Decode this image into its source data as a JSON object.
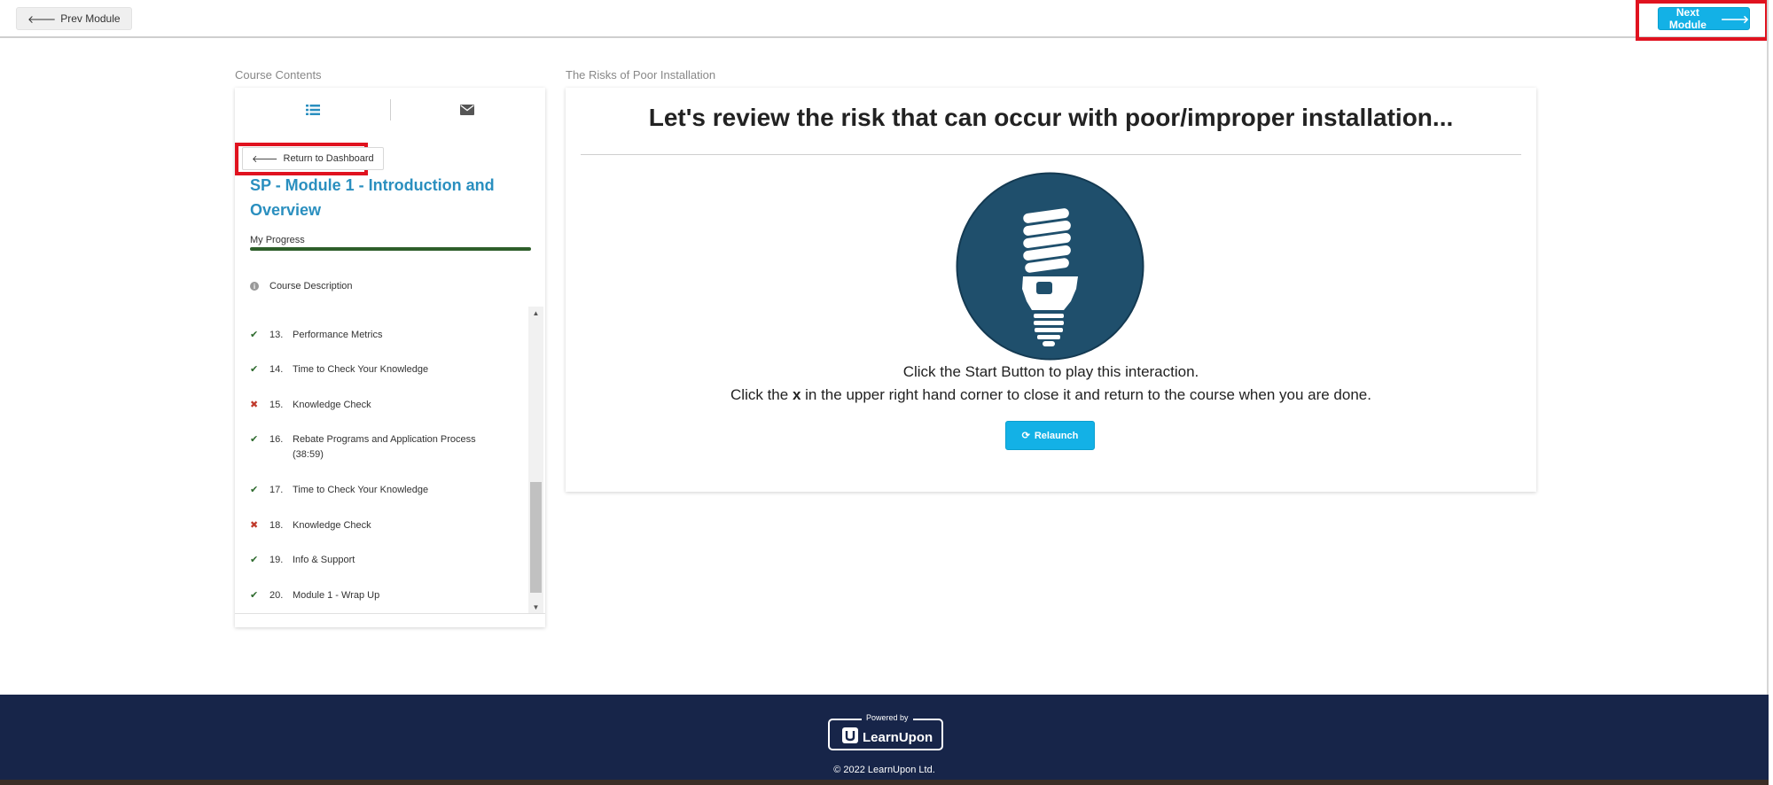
{
  "topbar": {
    "prev_label": "Prev Module",
    "next_label": "Next Module"
  },
  "sidebar": {
    "heading": "Course Contents",
    "return_label": "Return to Dashboard",
    "course_title": "SP - Module 1 - Introduction and Overview",
    "progress_label": "My Progress",
    "progress_fraction": 1.0,
    "course_description": "Course Description",
    "items": [
      {
        "num": "13.",
        "label": "Performance Metrics",
        "status": "done"
      },
      {
        "num": "14.",
        "label": "Time to Check Your Knowledge",
        "status": "done"
      },
      {
        "num": "15.",
        "label": "Knowledge Check",
        "status": "fail"
      },
      {
        "num": "16.",
        "label": "Rebate Programs and Application Process (38:59)",
        "status": "done"
      },
      {
        "num": "17.",
        "label": "Time to Check Your Knowledge",
        "status": "done"
      },
      {
        "num": "18.",
        "label": "Knowledge Check",
        "status": "fail"
      },
      {
        "num": "19.",
        "label": "Info & Support",
        "status": "done"
      },
      {
        "num": "20.",
        "label": "Module 1 - Wrap Up",
        "status": "done"
      }
    ]
  },
  "main": {
    "section_heading": "The Risks of Poor Installation",
    "heading": "Let's review the risk that can occur with poor/improper installation...",
    "instruction_1": "Click the Start Button to play this interaction.",
    "instruction_2_pre": "Click the ",
    "instruction_2_bold": "x",
    "instruction_2_post": " in the upper right hand corner to close it and return to the course when you are done.",
    "relaunch_label": "Relaunch"
  },
  "footer": {
    "powered_by": "Powered by",
    "brand": "LearnUpon",
    "copyright": "© 2022 LearnUpon Ltd."
  },
  "colors": {
    "accent": "#13b1e6",
    "title_blue": "#2a8fbf",
    "progress": "#2d5e2a",
    "footer_bg": "#172549",
    "highlight_red": "#e0121f",
    "bulb_circle": "#1f4f6c"
  },
  "icons": {
    "prev": "arrow-left-icon",
    "next": "arrow-right-icon",
    "contents_tab": "list-icon",
    "messages_tab": "envelope-icon",
    "return": "arrow-left-icon",
    "info": "info-icon",
    "done": "check-icon",
    "fail": "cross-icon",
    "relaunch": "refresh-icon",
    "lesson_image": "lightbulb-icon"
  }
}
